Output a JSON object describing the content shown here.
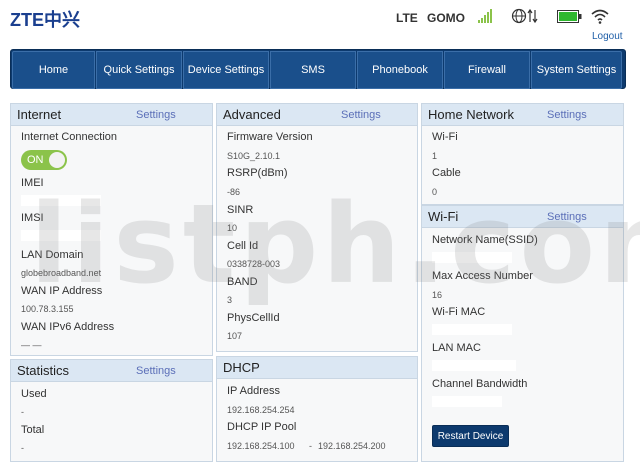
{
  "header": {
    "logo_left": "ZTE",
    "logo_right": "中兴",
    "network_type": "LTE",
    "operator": "GOMO",
    "logout": "Logout"
  },
  "colors": {
    "nav_bg": "#0d3a6e",
    "nav_item": "#1a4f8b",
    "panel_head": "#dbe7f3",
    "toggle_on": "#8bc34a",
    "settings_link": "#5b6fb8"
  },
  "nav": [
    "Home",
    "Quick Settings",
    "Device Settings",
    "SMS",
    "Phonebook",
    "Firewall",
    "System Settings"
  ],
  "internet": {
    "title": "Internet",
    "settings": "Settings",
    "connection_label": "Internet Connection",
    "toggle_label": "ON",
    "imei_label": "IMEI",
    "imsi_label": "IMSI",
    "lan_domain_label": "LAN Domain",
    "lan_domain_value": "globebroadband.net",
    "wan_ip_label": "WAN IP Address",
    "wan_ip_value": "100.78.3.155",
    "wan_ipv6_label": "WAN IPv6 Address",
    "wan_ipv6_value": "— —"
  },
  "statistics": {
    "title": "Statistics",
    "settings": "Settings",
    "used_label": "Used",
    "used_value": "-",
    "total_label": "Total",
    "total_value": "-"
  },
  "advanced": {
    "title": "Advanced",
    "settings": "Settings",
    "firmware_label": "Firmware Version",
    "firmware_value": "S10G_2.10.1",
    "rsrp_label": "RSRP(dBm)",
    "rsrp_value": "-86",
    "sinr_label": "SINR",
    "sinr_value": "10",
    "cellid_label": "Cell Id",
    "cellid_value": "0338728-003",
    "band_label": "BAND",
    "band_value": "3",
    "physcellid_label": "PhysCellId",
    "physcellid_value": "107"
  },
  "dhcp": {
    "title": "DHCP",
    "ip_label": "IP Address",
    "ip_value": "192.168.254.254",
    "pool_label": "DHCP IP Pool",
    "pool_start": "192.168.254.100",
    "pool_sep": "-",
    "pool_end": "192.168.254.200"
  },
  "home_network": {
    "title": "Home Network",
    "settings": "Settings",
    "wifi_label": "Wi-Fi",
    "wifi_value": "1",
    "cable_label": "Cable",
    "cable_value": "0"
  },
  "wifi": {
    "title": "Wi-Fi",
    "settings": "Settings",
    "ssid_label": "Network Name(SSID)",
    "max_access_label": "Max Access Number",
    "max_access_value": "16",
    "wifi_mac_label": "Wi-Fi MAC",
    "lan_mac_label": "LAN MAC",
    "channel_bw_label": "Channel Bandwidth",
    "restart_label": "Restart Device"
  },
  "watermark": "listph.com",
  "icons": {
    "signal": "signal-bars-icon",
    "globe": "globe-transfer-icon",
    "battery": "battery-icon",
    "wifi": "wifi-icon"
  }
}
